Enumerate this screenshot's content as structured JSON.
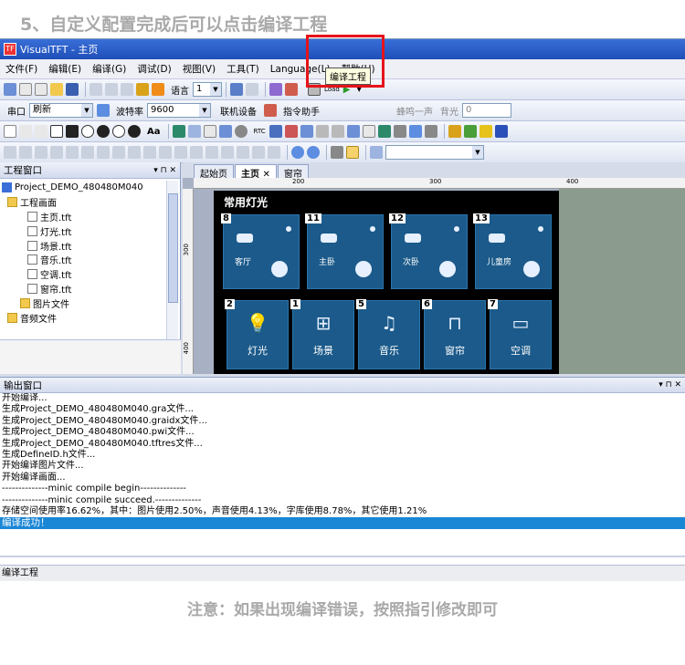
{
  "step_title": "5、自定义配置完成后可以点击编译工程",
  "note": "注意：如果出现编译错误，按照指引修改即可",
  "app": {
    "title": "VisualTFT - 主页",
    "logo": "TF",
    "menu": [
      "文件(F)",
      "编辑(E)",
      "编译(G)",
      "调试(D)",
      "视图(V)",
      "工具(T)",
      "Language(L)",
      "帮助(H)"
    ],
    "toolbar1": {
      "language_label": "语言",
      "language_value": "1",
      "load_label": "Load"
    },
    "toolbar2": {
      "port_label": "串口",
      "port_value": "刷新",
      "baud_label": "波特率",
      "baud_value": "9600",
      "connect_label": "联机设备",
      "assistant_label": "指令助手",
      "beep_label": "蜂鸣一声",
      "backlight_label": "背光",
      "backlight_value": "0"
    },
    "toolbar3": {
      "rtc_label": "RTC",
      "font_label": "Aa"
    },
    "tooltip": "编译工程",
    "project_pane": {
      "title": "工程窗口",
      "ctrl": "▾ ⊓ ✕",
      "items": [
        {
          "label": "Project_DEMO_480480M040",
          "type": "project"
        },
        {
          "label": "工程画面",
          "type": "folder"
        },
        {
          "label": "主页.tft",
          "type": "file"
        },
        {
          "label": "灯光.tft",
          "type": "file"
        },
        {
          "label": "场景.tft",
          "type": "file"
        },
        {
          "label": "音乐.tft",
          "type": "file"
        },
        {
          "label": "空调.tft",
          "type": "file"
        },
        {
          "label": "窗帘.tft",
          "type": "file"
        },
        {
          "label": "图片文件",
          "type": "folder"
        },
        {
          "label": "音频文件",
          "type": "folder"
        }
      ]
    },
    "tabs": [
      {
        "label": "起始页"
      },
      {
        "label": "主页 ✕"
      },
      {
        "label": "窗帘"
      }
    ],
    "ruler": {
      "h_200": "200",
      "h_300": "300",
      "h_400": "400",
      "v_300": "300",
      "v_400": "400"
    },
    "stage": {
      "title": "常用灯光",
      "rooms": [
        {
          "num": "8",
          "name": "客厅"
        },
        {
          "num": "11",
          "name": "主卧"
        },
        {
          "num": "12",
          "name": "次卧"
        },
        {
          "num": "13",
          "name": "儿童房"
        }
      ],
      "functions": [
        {
          "num": "2",
          "label": "灯光",
          "glyph": "💡"
        },
        {
          "num": "1",
          "label": "场景",
          "glyph": "⊞"
        },
        {
          "num": "5",
          "label": "音乐",
          "glyph": "♫"
        },
        {
          "num": "6",
          "label": "窗帘",
          "glyph": "⊓"
        },
        {
          "num": "7",
          "label": "空调",
          "glyph": "▭"
        }
      ]
    },
    "output_pane": {
      "title": "输出窗口",
      "ctrl": "▾ ⊓ ✕",
      "lines": [
        "开始编译...",
        "生成Project_DEMO_480480M040.gra文件...",
        "生成Project_DEMO_480480M040.graidx文件...",
        "生成Project_DEMO_480480M040.pwi文件...",
        "生成Project_DEMO_480480M040.tftres文件...",
        "生成DefineID.h文件...",
        "开始编译图片文件...",
        "开始编译画面...",
        "--------------minic compile begin--------------",
        "--------------minic compile succeed.--------------",
        "存储空间使用率16.62%，其中：图片使用2.50%，声音使用4.13%，字库使用8.78%，其它使用1.21%"
      ],
      "success": "编译成功！"
    },
    "status_text": "编译工程"
  }
}
